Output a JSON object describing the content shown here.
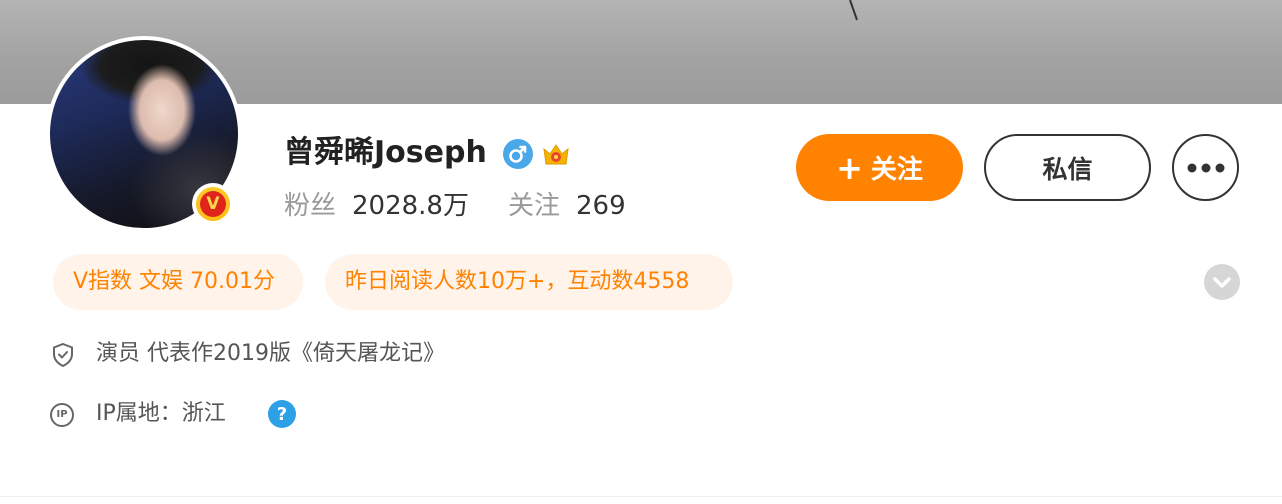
{
  "profile": {
    "name": "曾舜晞Joseph",
    "avatar_badge": "V",
    "gender_icon": "male-icon",
    "crown_icon": "crown-icon",
    "stats": {
      "fans_label": "粉丝",
      "fans_value": "2028.8万",
      "following_label": "关注",
      "following_value": "269"
    }
  },
  "actions": {
    "follow_plus": "+",
    "follow_label": "关注",
    "message_label": "私信",
    "more_icon": "ellipsis-icon"
  },
  "tags": [
    "V指数 文娱 70.01分",
    "昨日阅读人数10万+，互动数4558"
  ],
  "info": {
    "verification": "演员 代表作2019版《倚天屠龙记》",
    "ip_location": "IP属地：浙江",
    "ip_icon_text": "IP"
  },
  "colors": {
    "accent": "#ff8200",
    "tag_bg": "#fff3ea",
    "help_blue": "#2ea0e8",
    "cover_gray": "#a3a3a3"
  }
}
